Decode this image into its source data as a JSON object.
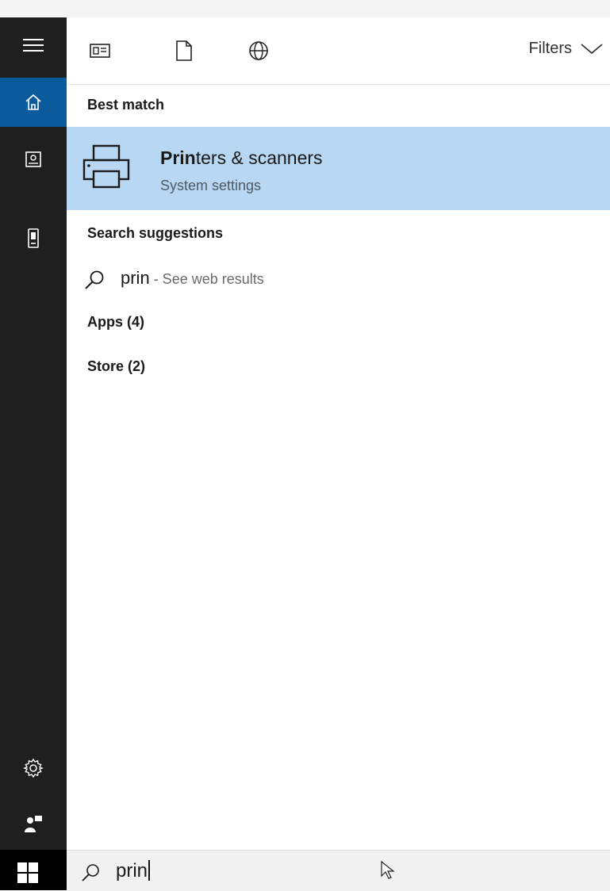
{
  "toolbar": {
    "icons": [
      "apps-icon",
      "documents-icon",
      "web-icon"
    ],
    "filters_label": "Filters"
  },
  "sidebar": {
    "items": [
      {
        "icon": "hamburger-menu-icon"
      },
      {
        "icon": "home-icon",
        "active": true
      },
      {
        "icon": "notebook-icon"
      },
      {
        "icon": "phone-icon"
      },
      {
        "icon": "gear-icon"
      },
      {
        "icon": "feedback-icon"
      }
    ]
  },
  "results": {
    "best_match_heading": "Best match",
    "best_match": {
      "title_bold": "Prin",
      "title_rest": "ters & scanners",
      "subtitle": "System settings",
      "icon": "printer-icon"
    },
    "search_suggestions_heading": "Search suggestions",
    "suggestion": {
      "query": "prin",
      "hint": " - See web results",
      "icon": "search-icon"
    },
    "apps_label": "Apps (4)",
    "store_label": "Store (2)"
  },
  "search": {
    "value": "prin"
  },
  "colors": {
    "rail": "#1f1f1f",
    "active_rail": "#0b5a9c",
    "highlight": "#b8d7f2"
  }
}
